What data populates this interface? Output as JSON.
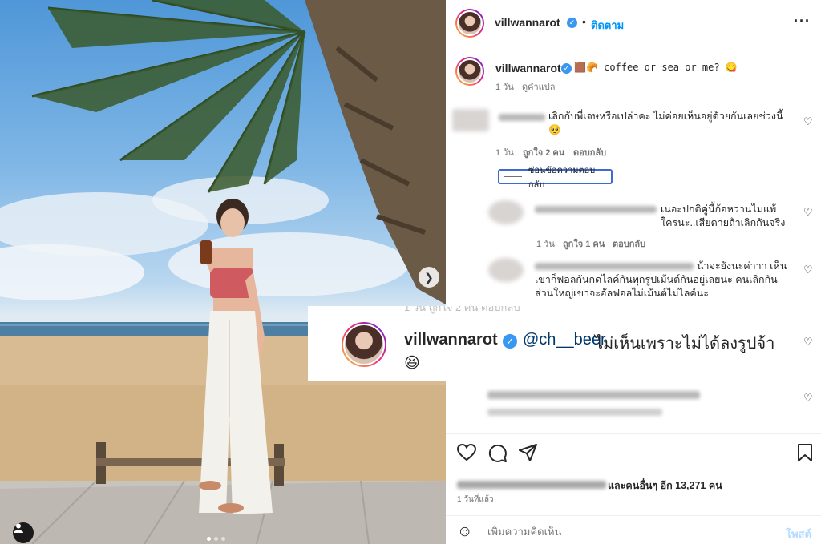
{
  "header": {
    "username": "villwannarot",
    "separator": "•",
    "follow_label": "ติดตาม",
    "more_icon": "more-icon"
  },
  "caption": {
    "username": "villwannarot",
    "text": "🟫🥐 coffee or sea or me? 😋",
    "time": "1 วัน",
    "translate": "ดูคำแปล"
  },
  "comments": [
    {
      "text": "เลิกกับพี่เจษหรือเปล่าคะ ไม่ค่อยเห็นอยู่ด้วยกันเลยช่วงนี้ 🥺",
      "time": "1 วัน",
      "likes": "ถูกใจ 2 คน",
      "reply": "ตอบกลับ"
    }
  ],
  "hide_replies_label": "ซ่อนข้อความตอบกลับ",
  "replies": [
    {
      "text": "เนอะปกติคู่นี้ก้อหวานไม่แพ้ใครนะ..เสียดายถ้าเลิกกันจริง",
      "time": "1 วัน",
      "likes": "ถูกใจ 1 คน",
      "reply": "ตอบกลับ"
    },
    {
      "text": "น้าจะยังนะค่าาา เห็นเขาก็ฟอลกันกดไลค์กันทุกรูปเม้นต์กันอยู่เลยนะ คนเลิกกันส่วนใหญ่เขาจะอัลฟอลไม่เม้นต์ไม่ไลค์นะ"
    }
  ],
  "zoom": {
    "strip_text": "1 วัน    ถูกใจ 2 คน    ตอบกลับ",
    "username": "villwannarot",
    "mention": "@ch__beer",
    "text": "ไม่เห็นเพราะไม่ได้ลงรูปจ้า",
    "emoji": "😆"
  },
  "actions": {
    "likes_text": "และคนอื่นๆ อีก 13,271 คน",
    "time_ago": "1 วันที่แล้ว"
  },
  "comment_box": {
    "placeholder": "เพิ่มความคิดเห็น",
    "post_label": "โพสต์"
  },
  "colors": {
    "link_blue": "#0095f6",
    "verified_blue": "#3897f0",
    "post_disabled": "#b3dbff",
    "highlight_border": "#3d6bd0"
  }
}
